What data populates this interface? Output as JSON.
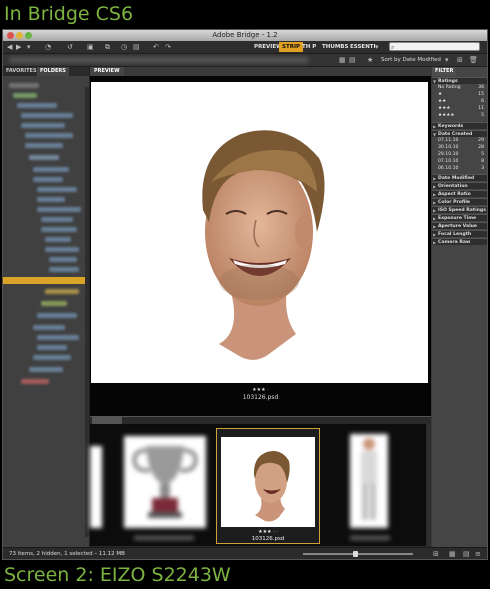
{
  "captions": {
    "top": "In Bridge CS6",
    "bottom": "Screen 2: EIZO S2243W"
  },
  "window": {
    "title": "Adobe Bridge - 1.2"
  },
  "toolbar": {
    "workspaces": [
      "PREVIEW",
      "STRIP",
      "TH P",
      "THUMBS",
      "ESSENTI"
    ],
    "active_workspace": "STRIP",
    "search_placeholder": "",
    "icons": [
      "back-arrow-icon",
      "forward-arrow-icon",
      "reveal-icon",
      "rotate-icon",
      "camera-icon",
      "refine-icon",
      "open-recent-icon",
      "undo-icon",
      "redo-icon",
      "search-icon"
    ]
  },
  "pathbar": {
    "sort_label": "Sort by Date Modified"
  },
  "left_panel": {
    "tabs": [
      "FAVORITES",
      "FOLDERS"
    ],
    "active_tab": "FOLDERS"
  },
  "preview": {
    "tab_label": "PREVIEW",
    "rating": "★★★ ·",
    "filename": "103126.psd"
  },
  "strip": {
    "selected": {
      "rating": "★★★ · ·",
      "filename": "103126.psd"
    }
  },
  "filter": {
    "tab_label": "FILTER",
    "ratings_header": "Ratings",
    "ratings": [
      {
        "label": "No Rating",
        "count": "36"
      },
      {
        "label": "★",
        "count": "15"
      },
      {
        "label": "★★",
        "count": "6"
      },
      {
        "label": "★★★",
        "count": "11"
      },
      {
        "label": "★★★★",
        "count": "5"
      }
    ],
    "keywords_header": "Keywords",
    "date_header": "Date Created",
    "dates": [
      {
        "label": "07.11.10",
        "count": "29"
      },
      {
        "label": "30.10.10",
        "count": "28"
      },
      {
        "label": "29.10.10",
        "count": "5"
      },
      {
        "label": "07.10.10",
        "count": "8"
      },
      {
        "label": "06.10.10",
        "count": "3"
      }
    ],
    "more_headers": [
      "Date Modified",
      "Orientation",
      "Aspect Ratio",
      "Color Profile",
      "ISO Speed Ratings",
      "Exposure Time",
      "Aperture Value",
      "Focal Length",
      "Camera Raw"
    ]
  },
  "status": {
    "text": "73 items, 2 hidden, 1 selected – 11.12 MB"
  },
  "colors": {
    "caption": "#7db340",
    "accent": "#e0a022",
    "panel": "#3a3a3a"
  }
}
